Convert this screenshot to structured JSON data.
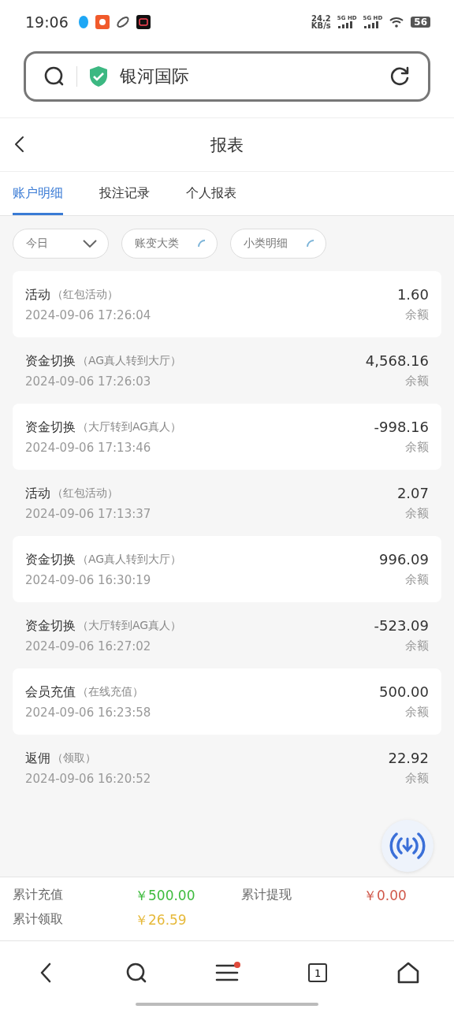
{
  "status_bar": {
    "time": "19:06",
    "speed": "24.2",
    "speed_unit": "KB/s",
    "networks": [
      "5G HD",
      "5G HD"
    ],
    "battery": "56"
  },
  "address_bar": {
    "site": "银河国际"
  },
  "header": {
    "title": "报表"
  },
  "tabs": [
    {
      "label": "账户明细",
      "selected": true
    },
    {
      "label": "投注记录",
      "selected": false
    },
    {
      "label": "个人报表",
      "selected": false
    }
  ],
  "filters": [
    {
      "label": "今日",
      "kind": "dropdown"
    },
    {
      "label": "账变大类",
      "kind": "loading"
    },
    {
      "label": "小类明细",
      "kind": "loading"
    }
  ],
  "records": [
    {
      "title": "活动",
      "note": "（红包活动）",
      "time": "2024-09-06 17:26:04",
      "amount": "1.60",
      "balance_label": "余额"
    },
    {
      "title": "资金切换",
      "note": "（AG真人转到大厅）",
      "time": "2024-09-06 17:26:03",
      "amount": "4,568.16",
      "balance_label": "余额"
    },
    {
      "title": "资金切换",
      "note": "（大厅转到AG真人）",
      "time": "2024-09-06 17:13:46",
      "amount": "-998.16",
      "balance_label": "余额"
    },
    {
      "title": "活动",
      "note": "（红包活动）",
      "time": "2024-09-06 17:13:37",
      "amount": "2.07",
      "balance_label": "余额"
    },
    {
      "title": "资金切换",
      "note": "（AG真人转到大厅）",
      "time": "2024-09-06 16:30:19",
      "amount": "996.09",
      "balance_label": "余额"
    },
    {
      "title": "资金切换",
      "note": "（大厅转到AG真人）",
      "time": "2024-09-06 16:27:02",
      "amount": "-523.09",
      "balance_label": "余额"
    },
    {
      "title": "会员充值",
      "note": "（在线充值）",
      "time": "2024-09-06 16:23:58",
      "amount": "500.00",
      "balance_label": "余额"
    },
    {
      "title": "返佣",
      "note": "（领取）",
      "time": "2024-09-06 16:20:52",
      "amount": "22.92",
      "balance_label": "余额"
    }
  ],
  "summary": [
    {
      "label": "累计充值",
      "value": "￥500.00",
      "color": "#3dbb3d"
    },
    {
      "label": "累计提现",
      "value": "￥0.00",
      "color": "#d0584a"
    },
    {
      "label": "累计领取",
      "value": "￥26.59",
      "color": "#e6b93a"
    }
  ],
  "bottom_nav": {
    "tab_count": "1",
    "menu_badge": true
  }
}
